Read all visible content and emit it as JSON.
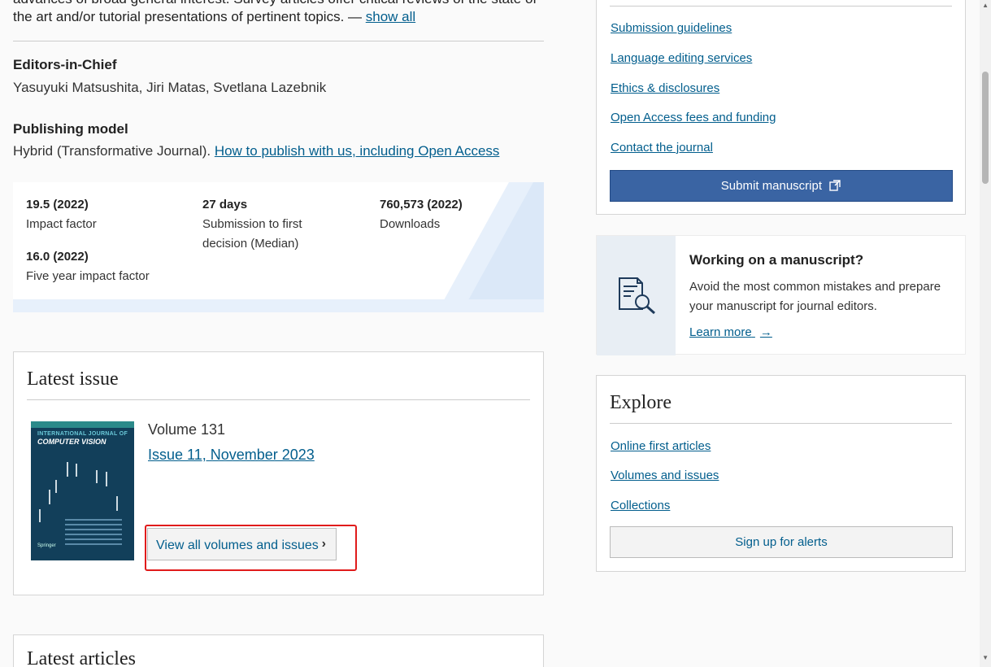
{
  "journal": {
    "description_tail": "advances of broad general interest. Survey articles offer critical reviews of the state of the art and/or tutorial presentations of pertinent topics. — ",
    "show_all": "show all",
    "editors_label": "Editors-in-Chief",
    "editors": "Yasuyuki Matsushita, Jiri Matas, Svetlana Lazebnik",
    "publishing_label": "Publishing model",
    "publishing_text": "Hybrid (Transformative Journal). ",
    "publishing_link": "How to publish with us, including Open Access"
  },
  "metrics": [
    {
      "value": "19.5 (2022)",
      "label": "Impact factor"
    },
    {
      "value": "27 days",
      "label": "Submission to first decision (Median)"
    },
    {
      "value": "760,573 (2022)",
      "label": "Downloads"
    },
    {
      "value": "16.0 (2022)",
      "label": "Five year impact factor"
    }
  ],
  "latest_issue": {
    "heading": "Latest issue",
    "cover_title_small": "INTERNATIONAL JOURNAL OF",
    "cover_title": "COMPUTER VISION",
    "cover_publisher": "Springer",
    "volume": "Volume 131",
    "issue": "Issue 11, November 2023",
    "view_all": "View all volumes and issues",
    "chevron": "›"
  },
  "latest_articles": {
    "heading": "Latest articles"
  },
  "sidebar": {
    "links": [
      "Submission guidelines",
      "Language editing services",
      "Ethics & disclosures",
      "Open Access fees and funding",
      "Contact the journal"
    ],
    "submit": "Submit manuscript",
    "manuscript": {
      "title": "Working on a manuscript?",
      "text": "Avoid the most common mistakes and prepare your manuscript for journal editors.",
      "link": "Learn more",
      "arrow": "→"
    },
    "explore": {
      "heading": "Explore",
      "links": [
        "Online first articles",
        "Volumes and issues",
        "Collections"
      ],
      "alerts": "Sign up for alerts"
    }
  },
  "colors": {
    "link": "#025e8d",
    "primary_button": "#3a64a3",
    "highlight": "#e01b1b"
  },
  "icons": [
    "external-link-icon",
    "document-search-icon",
    "chevron-right-icon",
    "arrow-right-icon"
  ]
}
